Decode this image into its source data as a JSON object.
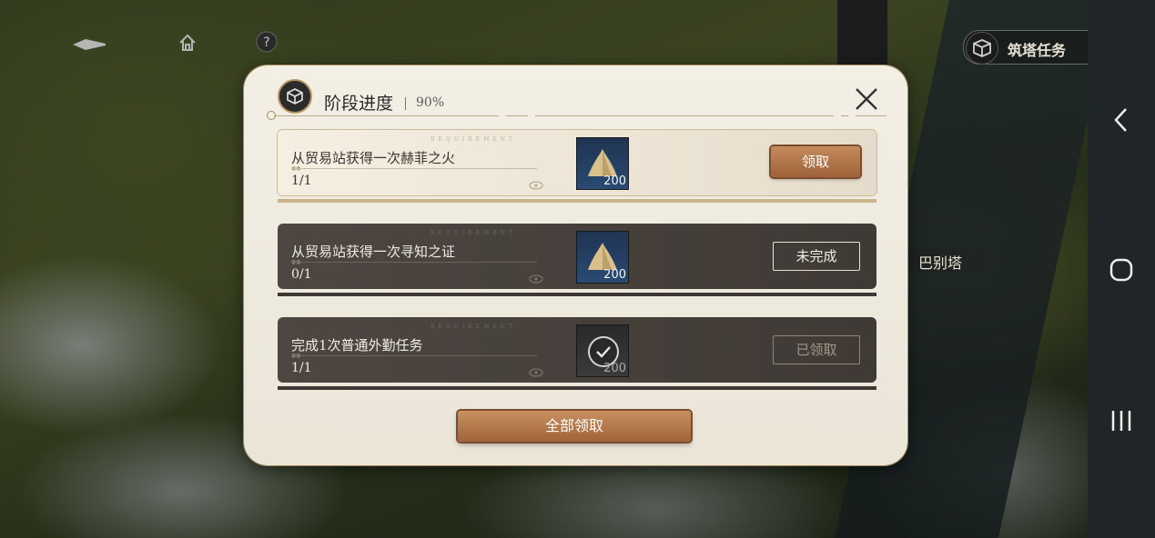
{
  "top_bar": {
    "task_badge_label": "筑塔任务"
  },
  "map": {
    "location_label": "巴别塔"
  },
  "modal": {
    "title": "阶段进度",
    "progress_percent": "90%",
    "tasks": [
      {
        "requirement_tag": "REQUIREMENT",
        "title": "从贸易站获得一次赫菲之火",
        "progress": "1/1",
        "reward_quantity": "200",
        "status_label": "领取",
        "status": "claimable"
      },
      {
        "requirement_tag": "REQUIREMENT",
        "title": "从贸易站获得一次寻知之证",
        "progress": "0/1",
        "reward_quantity": "200",
        "status_label": "未完成",
        "status": "incomplete"
      },
      {
        "requirement_tag": "REQUIREMENT",
        "title": "完成1次普通外勤任务",
        "progress": "1/1",
        "reward_quantity": "200",
        "status_label": "已领取",
        "status": "claimed"
      }
    ],
    "claim_all_label": "全部领取"
  },
  "colors": {
    "accent_bronze": "#b07445",
    "modal_bg": "#efeae0",
    "dark_card": "#46403b"
  }
}
